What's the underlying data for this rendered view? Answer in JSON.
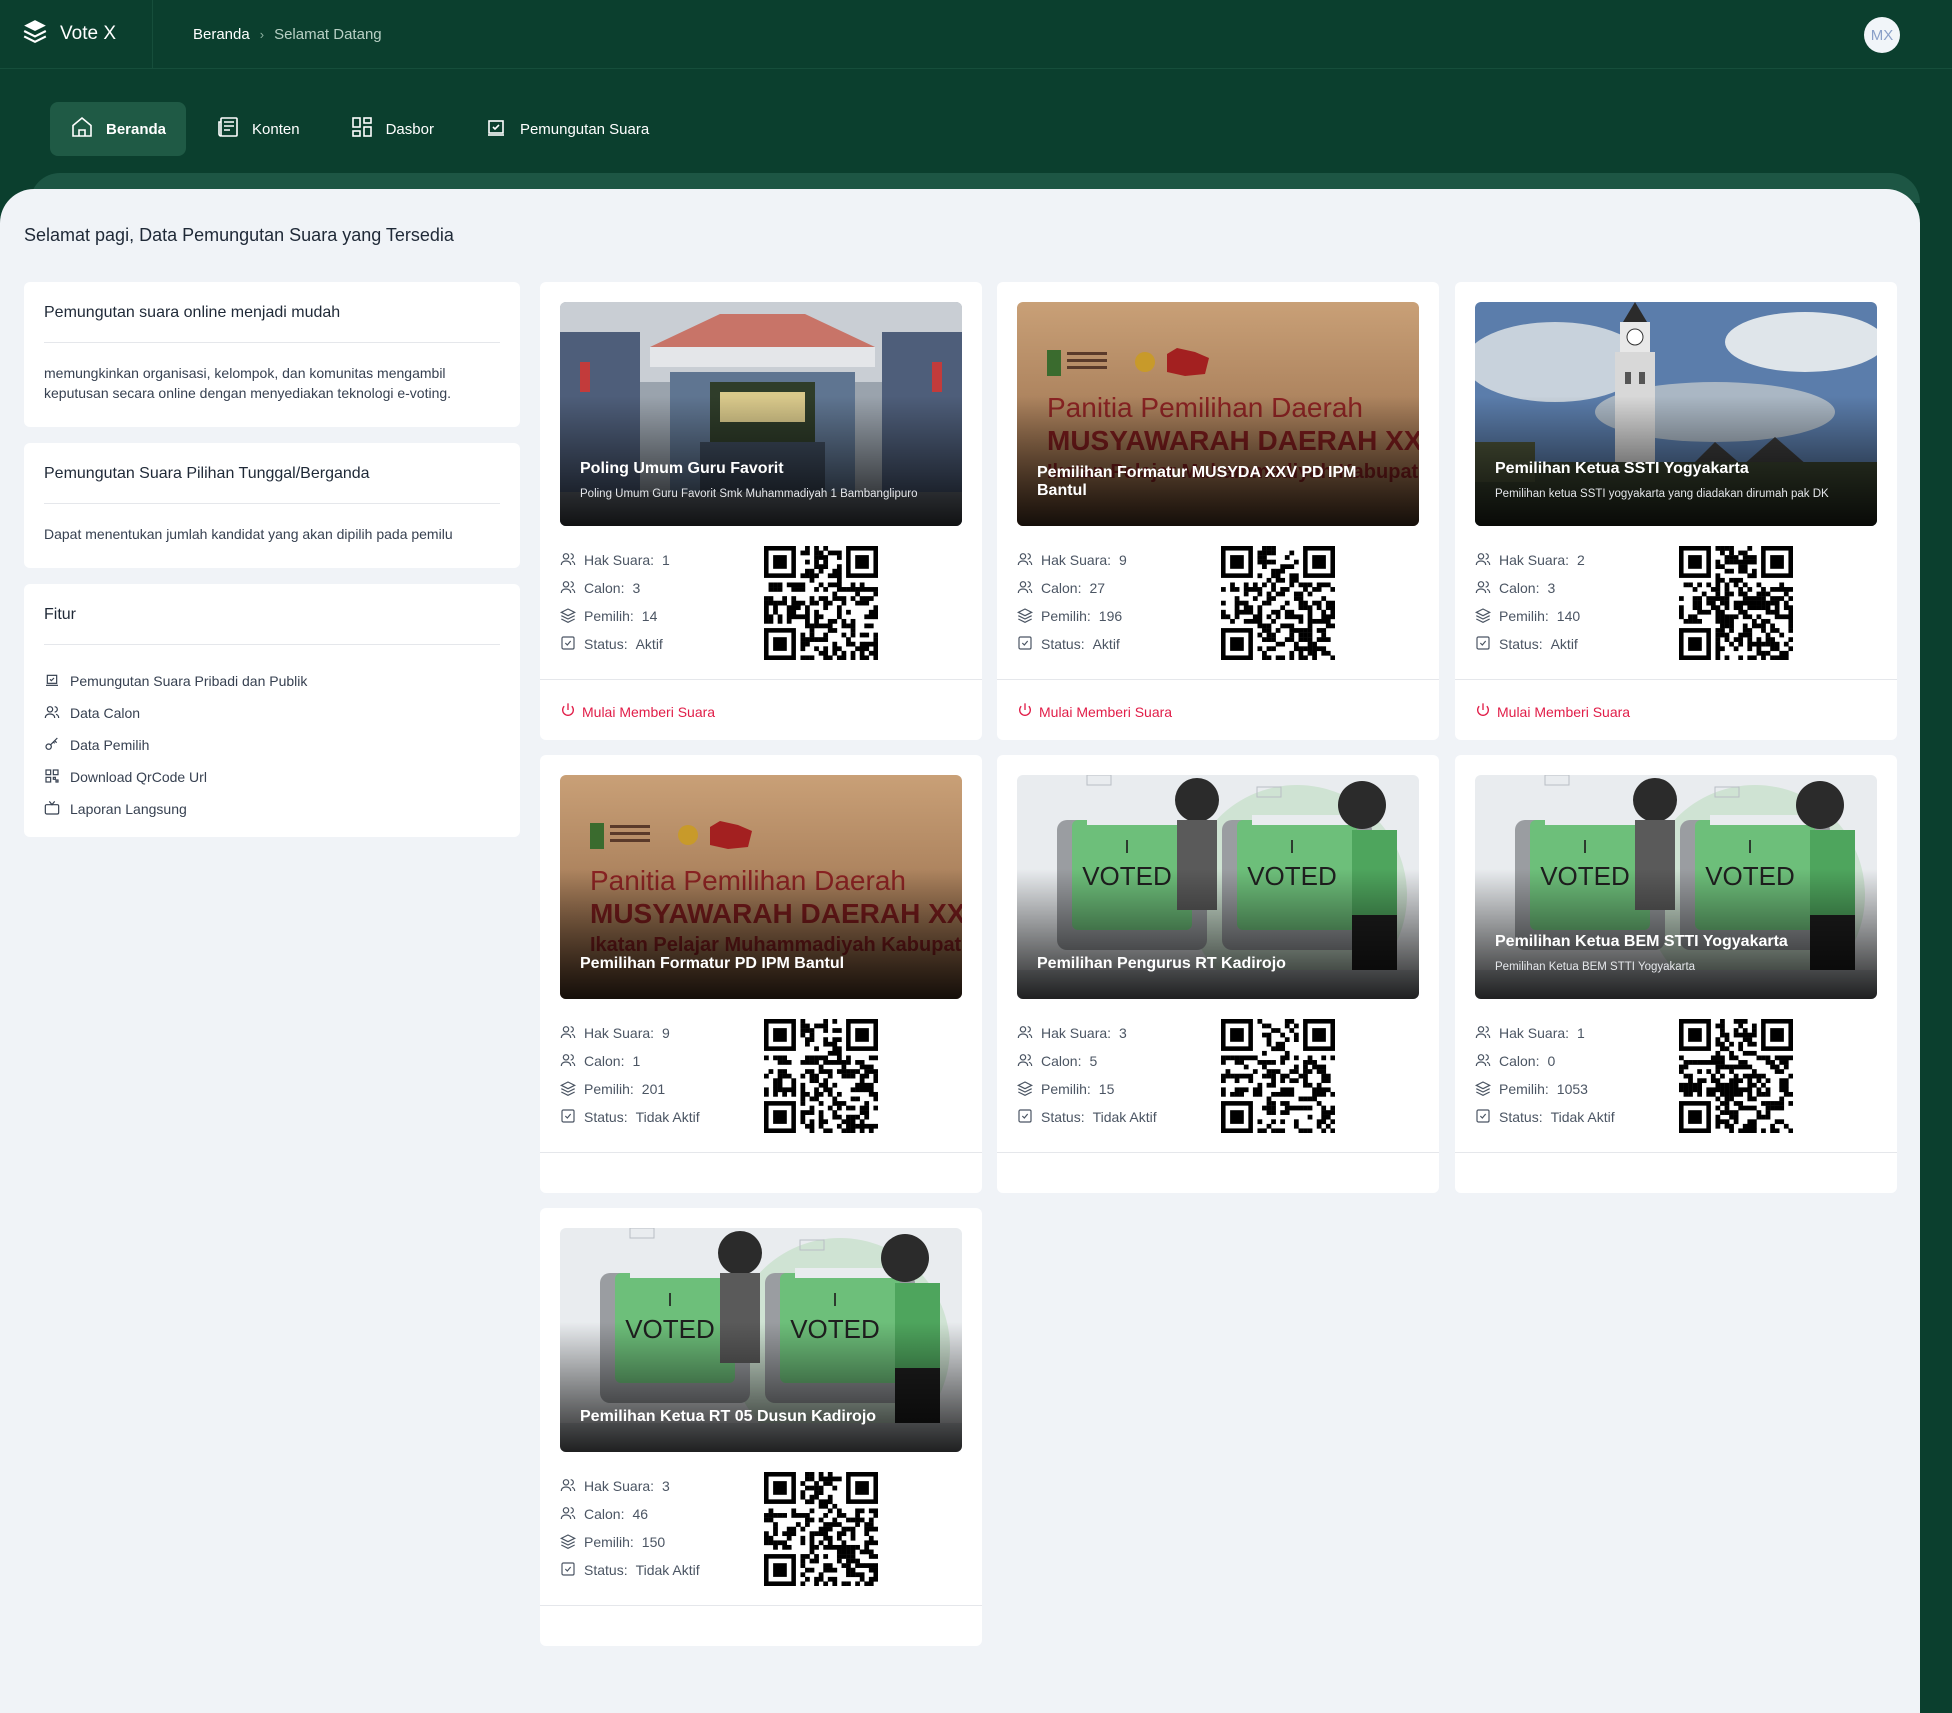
{
  "app": {
    "name": "Vote X",
    "avatar_initials": "MX"
  },
  "breadcrumb": {
    "home": "Beranda",
    "current": "Selamat Datang"
  },
  "nav": [
    {
      "label": "Beranda",
      "icon": "home-icon",
      "active": true
    },
    {
      "label": "Konten",
      "icon": "news-icon",
      "active": false
    },
    {
      "label": "Dasbor",
      "icon": "dashboard-icon",
      "active": false
    },
    {
      "label": "Pemungutan Suara",
      "icon": "vote-icon",
      "active": false
    }
  ],
  "page_title": "Selamat pagi, Data Pemungutan Suara yang Tersedia",
  "info": [
    {
      "title": "Pemungutan suara online menjadi mudah",
      "body": "memungkinkan organisasi, kelompok, dan komunitas mengambil keputusan secara online dengan menyediakan teknologi e-voting."
    },
    {
      "title": "Pemungutan Suara Pilihan Tunggal/Berganda",
      "body": "Dapat menentukan jumlah kandidat yang akan dipilih pada pemilu"
    }
  ],
  "features": {
    "title": "Fitur",
    "items": [
      {
        "label": "Pemungutan Suara Pribadi dan Publik",
        "icon": "ballot-icon"
      },
      {
        "label": "Data Calon",
        "icon": "users-icon"
      },
      {
        "label": "Data Pemilih",
        "icon": "key-icon"
      },
      {
        "label": "Download QrCode Url",
        "icon": "qrcode-icon"
      },
      {
        "label": "Laporan Langsung",
        "icon": "tv-icon"
      }
    ]
  },
  "colors": {
    "primary": "#0b3f2e",
    "active_nav": "#1f5a45",
    "accent": "#e11d48",
    "panel": "#f0f3f7"
  },
  "start_label": "Mulai Memberi Suara",
  "labels": {
    "hak_suara": "Hak Suara:",
    "calon": "Calon:",
    "pemilih": "Pemilih:",
    "status": "Status:"
  },
  "votes": [
    {
      "title": "Poling Umum Guru Favorit",
      "desc": "Poling Umum Guru Favorit Smk Muhammadiyah 1 Bambanglipuro",
      "image": "school-building",
      "hak_suara": "1",
      "calon": "3",
      "pemilih": "14",
      "status": "Aktif",
      "can_start": true
    },
    {
      "title": "Pemilihan Formatur MUSYDA XXV PD IPM Bantul",
      "desc": "",
      "image": "ipm-banner",
      "hak_suara": "9",
      "calon": "27",
      "pemilih": "196",
      "status": "Aktif",
      "can_start": true
    },
    {
      "title": "Pemilihan Ketua SSTI Yogyakarta",
      "desc": "Pemilihan ketua SSTI yogyakarta yang diadakan dirumah pak DK",
      "image": "clock-tower",
      "hak_suara": "2",
      "calon": "3",
      "pemilih": "140",
      "status": "Aktif",
      "can_start": true
    },
    {
      "title": "Pemilihan Formatur PD IPM Bantul",
      "desc": "",
      "image": "ipm-banner",
      "hak_suara": "9",
      "calon": "1",
      "pemilih": "201",
      "status": "Tidak Aktif",
      "can_start": false
    },
    {
      "title": "Pemilihan Pengurus RT Kadirojo",
      "desc": "",
      "image": "voted-illustration",
      "hak_suara": "3",
      "calon": "5",
      "pemilih": "15",
      "status": "Tidak Aktif",
      "can_start": false
    },
    {
      "title": "Pemilihan Ketua BEM STTI Yogyakarta",
      "desc": "Pemilihan Ketua BEM STTI Yogyakarta",
      "image": "voted-illustration",
      "hak_suara": "1",
      "calon": "0",
      "pemilih": "1053",
      "status": "Tidak Aktif",
      "can_start": false
    },
    {
      "title": "Pemilihan Ketua RT 05 Dusun Kadirojo",
      "desc": "",
      "image": "voted-illustration",
      "hak_suara": "3",
      "calon": "46",
      "pemilih": "150",
      "status": "Tidak Aktif",
      "can_start": false
    }
  ],
  "banner_text": {
    "line1": "Panitia Pemilihan Daerah",
    "line2": "MUSYAWARAH DAERAH XXV",
    "line3": "Ikatan Pelajar Muhammadiyah Kabupaten",
    "voted": "VOTED",
    "voted_i": "I"
  }
}
